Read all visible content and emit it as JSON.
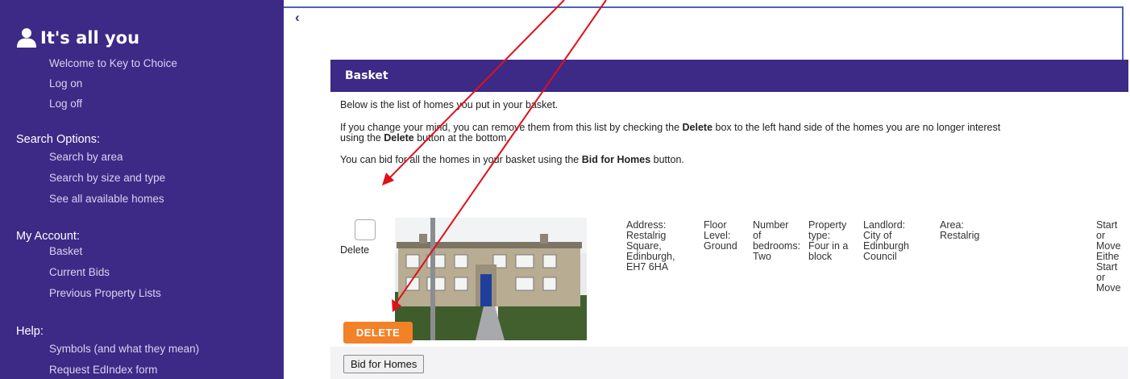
{
  "sidebar": {
    "title": "It's all you",
    "links_top": [
      "Welcome to Key to Choice",
      "Log on",
      "Log off"
    ],
    "search_heading": "Search Options:",
    "search_links": [
      "Search by area",
      "Search by size and type",
      "See all available homes"
    ],
    "account_heading": "My Account:",
    "account_links": [
      "Basket",
      "Current Bids",
      "Previous Property Lists"
    ],
    "help_heading": "Help:",
    "help_links": [
      "Symbols (and what they mean)",
      "Request EdIndex form"
    ]
  },
  "main": {
    "collapse_glyph": "‹"
  },
  "basket": {
    "title": "Basket",
    "intro": "Below is the list of homes you put in your basket.",
    "remove_text_1": "If you change your mind, you can remove them from this list by checking the ",
    "remove_bold_1": "Delete",
    "remove_text_2": " box to the left hand side of the homes you are no longer interest",
    "remove_line2_text_1": "using the ",
    "remove_line2_bold": "Delete",
    "remove_line2_text_2": " button at the bottom.",
    "bid_text_1": "You can bid for all the homes in your basket using the ",
    "bid_bold": "Bid for Homes",
    "bid_text_2": " button.",
    "delete_label": "Delete",
    "property": {
      "address": "Address:\nRestalrig\nSquare,\nEdinburgh,\nEH7 6HA",
      "floor": "Floor\nLevel:\nGround",
      "bedrooms": "Number\nof\nbedrooms:\nTwo",
      "type": "Property\ntype:\nFour in a\nblock",
      "landlord": "Landlord:\nCity of\nEdinburgh\nCouncil",
      "area": "Area:\nRestalrig",
      "start": "Start\nor\nMove\nEithe\nStart\nor\nMove"
    },
    "delete_button": "DELETE",
    "bid_button": "Bid for Homes"
  },
  "colors": {
    "sidebar_bg": "#3c2a86",
    "accent_orange": "#f28128",
    "arrow_red": "#e0101a"
  }
}
